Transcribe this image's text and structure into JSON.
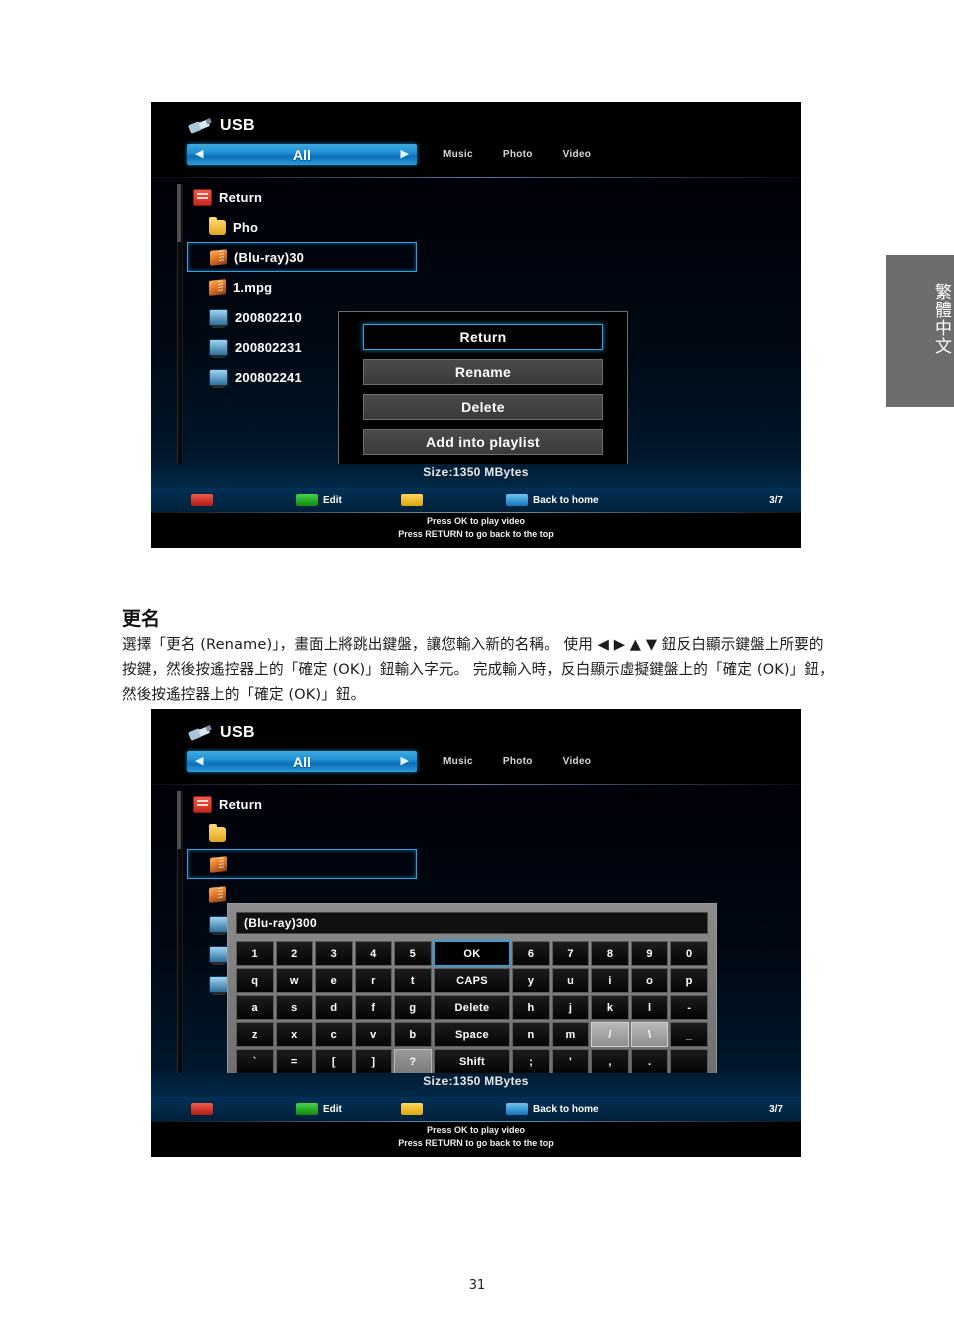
{
  "page": {
    "number": "31",
    "side_tab": "繁體中文"
  },
  "doc": {
    "heading": "更名",
    "body": "選擇「更名 (Rename)」，畫面上將跳出鍵盤，讓您輸入新的名稱。 使用 ◀ ▶ ▲ ▼ 鈕反白顯示鍵盤上所要的按鍵，然後按遙控器上的「確定 (OK)」鈕輸入字元。 完成輸入時，反白顯示虛擬鍵盤上的「確定 (OK)」鈕，然後按遙控器上的「確定 (OK)」鈕。"
  },
  "tv": {
    "title": "USB",
    "nav": {
      "left_arrow": "◀",
      "selected": "All",
      "right_arrow": "▶"
    },
    "categories": [
      "Music",
      "Photo",
      "Video"
    ],
    "files": [
      {
        "label": "Return",
        "icon": "return-icon",
        "indent": false,
        "selected": false
      },
      {
        "label": "Pho",
        "icon": "folder-icon",
        "indent": true,
        "selected": false
      },
      {
        "label": "(Blu-ray)30",
        "icon": "media-file-icon",
        "indent": true,
        "selected": true
      },
      {
        "label": "1.mpg",
        "icon": "media-file-icon",
        "indent": true,
        "selected": false
      },
      {
        "label": "200802210",
        "icon": "video-file-icon",
        "indent": true,
        "selected": false
      },
      {
        "label": "200802231",
        "icon": "video-file-icon",
        "indent": true,
        "selected": false
      },
      {
        "label": "200802241",
        "icon": "video-file-icon",
        "indent": true,
        "selected": false
      }
    ],
    "size": "Size:1350 MBytes",
    "color_buttons": [
      {
        "color": "red",
        "label": ""
      },
      {
        "color": "green",
        "label": "Edit"
      },
      {
        "color": "yellow",
        "label": ""
      },
      {
        "color": "blue",
        "label": "Back to home"
      }
    ],
    "pager": "3/7",
    "hint_line1": "Press OK to play video",
    "hint_line2": "Press RETURN to go back to the top"
  },
  "context_menu": {
    "items": [
      {
        "label": "Return",
        "focused": true
      },
      {
        "label": "Rename",
        "focused": false
      },
      {
        "label": "Delete",
        "focused": false
      },
      {
        "label": "Add into playlist",
        "focused": false
      }
    ]
  },
  "keyboard": {
    "input_value": "(Blu-ray)300",
    "rows": [
      [
        {
          "label": "1",
          "state": "normal"
        },
        {
          "label": "2",
          "state": "normal"
        },
        {
          "label": "3",
          "state": "normal"
        },
        {
          "label": "4",
          "state": "normal"
        },
        {
          "label": "5",
          "state": "normal"
        },
        {
          "label": "OK",
          "state": "focus",
          "wide": true
        },
        {
          "label": "6",
          "state": "normal"
        },
        {
          "label": "7",
          "state": "normal"
        },
        {
          "label": "8",
          "state": "normal"
        },
        {
          "label": "9",
          "state": "normal"
        },
        {
          "label": "0",
          "state": "normal"
        }
      ],
      [
        {
          "label": "q",
          "state": "normal"
        },
        {
          "label": "w",
          "state": "normal"
        },
        {
          "label": "e",
          "state": "normal"
        },
        {
          "label": "r",
          "state": "normal"
        },
        {
          "label": "t",
          "state": "normal"
        },
        {
          "label": "CAPS",
          "state": "normal",
          "wide": true
        },
        {
          "label": "y",
          "state": "normal"
        },
        {
          "label": "u",
          "state": "normal"
        },
        {
          "label": "i",
          "state": "normal"
        },
        {
          "label": "o",
          "state": "normal"
        },
        {
          "label": "p",
          "state": "normal"
        }
      ],
      [
        {
          "label": "a",
          "state": "normal"
        },
        {
          "label": "s",
          "state": "normal"
        },
        {
          "label": "d",
          "state": "normal"
        },
        {
          "label": "f",
          "state": "normal"
        },
        {
          "label": "g",
          "state": "normal"
        },
        {
          "label": "Delete",
          "state": "normal",
          "wide": true
        },
        {
          "label": "h",
          "state": "normal"
        },
        {
          "label": "j",
          "state": "normal"
        },
        {
          "label": "k",
          "state": "normal"
        },
        {
          "label": "l",
          "state": "normal"
        },
        {
          "label": "-",
          "state": "normal"
        }
      ],
      [
        {
          "label": "z",
          "state": "normal"
        },
        {
          "label": "x",
          "state": "normal"
        },
        {
          "label": "c",
          "state": "normal"
        },
        {
          "label": "v",
          "state": "normal"
        },
        {
          "label": "b",
          "state": "normal"
        },
        {
          "label": "Space",
          "state": "normal",
          "wide": true
        },
        {
          "label": "n",
          "state": "normal"
        },
        {
          "label": "m",
          "state": "normal"
        },
        {
          "label": "/",
          "state": "lit"
        },
        {
          "label": "\\",
          "state": "lit"
        },
        {
          "label": "_",
          "state": "normal"
        }
      ],
      [
        {
          "label": "`",
          "state": "normal"
        },
        {
          "label": "=",
          "state": "normal"
        },
        {
          "label": "[",
          "state": "normal"
        },
        {
          "label": "]",
          "state": "normal"
        },
        {
          "label": "?",
          "state": "dimlit"
        },
        {
          "label": "Shift",
          "state": "normal",
          "wide": true
        },
        {
          "label": ";",
          "state": "normal"
        },
        {
          "label": "'",
          "state": "normal"
        },
        {
          "label": ",",
          "state": "normal"
        },
        {
          "label": ".",
          "state": "normal"
        },
        {
          "label": "",
          "state": "normal"
        }
      ]
    ]
  },
  "colors": {
    "accent_blue": "#2ba3e8",
    "nav_blue": "#1f8fd4",
    "panel_gray": "#6d6d6d",
    "red": "#b51d12",
    "green": "#11890f",
    "yellow": "#dfa312"
  }
}
